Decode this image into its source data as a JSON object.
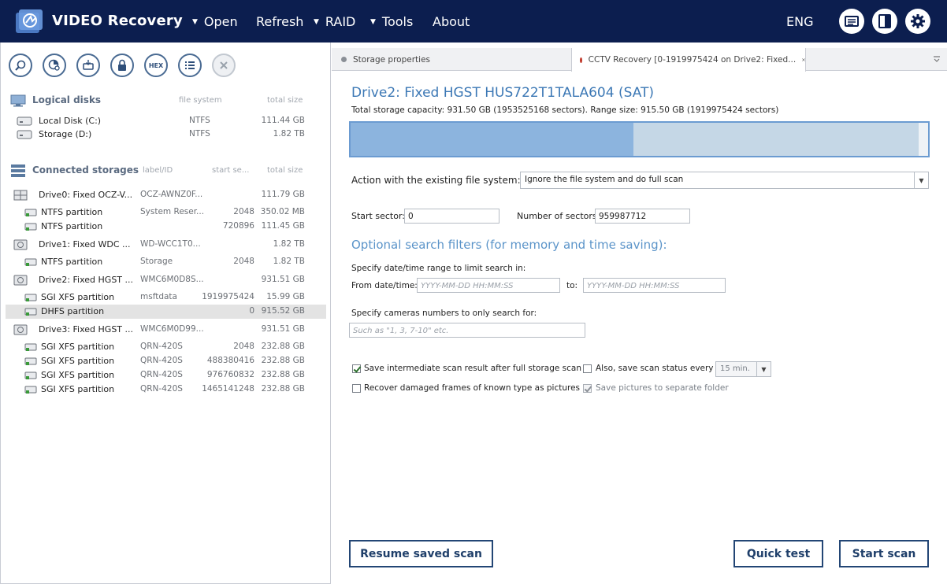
{
  "app": {
    "title": "VIDEO Recovery",
    "menu": [
      {
        "label": "Open",
        "has_caret": true
      },
      {
        "label": "Refresh",
        "has_caret": false
      },
      {
        "label": "RAID",
        "has_caret": true
      },
      {
        "label": "Tools",
        "has_caret": true
      },
      {
        "label": "About",
        "has_caret": false
      }
    ],
    "language": "ENG",
    "top_icons": [
      "log-icon",
      "panel-toggle-icon",
      "settings-icon"
    ]
  },
  "toolbar": {
    "buttons": [
      "find-icon",
      "partition-search-icon",
      "image-icon",
      "lock-icon",
      "hex-icon",
      "list-icon",
      "close-icon"
    ],
    "hex_label": "HEX"
  },
  "logical_disks": {
    "title": "Logical disks",
    "col_fs": "file system",
    "col_size": "total size",
    "items": [
      {
        "name": "Local Disk (C:)",
        "fs": "NTFS",
        "size": "111.44 GB"
      },
      {
        "name": "Storage (D:)",
        "fs": "NTFS",
        "size": "1.82 TB"
      }
    ]
  },
  "storages": {
    "title": "Connected storages",
    "col_label": "label/ID",
    "col_start": "start se...",
    "col_size": "total size",
    "rows": [
      {
        "kind": "drive",
        "name": "Drive0: Fixed OCZ-V...",
        "label": "OCZ-AWNZ0F...",
        "start": "",
        "size": "111.79 GB"
      },
      {
        "kind": "part",
        "name": "NTFS partition",
        "label": "System Reser...",
        "start": "2048",
        "size": "350.02 MB"
      },
      {
        "kind": "part",
        "name": "NTFS partition",
        "label": "",
        "start": "720896",
        "size": "111.45 GB"
      },
      {
        "kind": "drive",
        "name": "Drive1: Fixed WDC ...",
        "label": "WD-WCC1T0...",
        "start": "",
        "size": "1.82 TB"
      },
      {
        "kind": "part",
        "name": "NTFS partition",
        "label": "Storage",
        "start": "2048",
        "size": "1.82 TB"
      },
      {
        "kind": "drive",
        "name": "Drive2: Fixed HGST ...",
        "label": "WMC6M0D8S...",
        "start": "",
        "size": "931.51 GB"
      },
      {
        "kind": "part",
        "name": "SGI XFS partition",
        "label": "msftdata",
        "start": "1919975424",
        "size": "15.99 GB"
      },
      {
        "kind": "part-sel",
        "name": "DHFS partition",
        "label": "",
        "start": "0",
        "size": "915.52 GB"
      },
      {
        "kind": "drive",
        "name": "Drive3: Fixed HGST ...",
        "label": "WMC6M0D99...",
        "start": "",
        "size": "931.51 GB"
      },
      {
        "kind": "part",
        "name": "SGI XFS partition",
        "label": "QRN-420S",
        "start": "2048",
        "size": "232.88 GB"
      },
      {
        "kind": "part",
        "name": "SGI XFS partition",
        "label": "QRN-420S",
        "start": "488380416",
        "size": "232.88 GB"
      },
      {
        "kind": "part",
        "name": "SGI XFS partition",
        "label": "QRN-420S",
        "start": "976760832",
        "size": "232.88 GB"
      },
      {
        "kind": "part",
        "name": "SGI XFS partition",
        "label": "QRN-420S",
        "start": "1465141248",
        "size": "232.88 GB"
      }
    ]
  },
  "tabs": [
    {
      "label": "Storage properties",
      "dot_color": "#8a8f96"
    },
    {
      "label": "CCTV Recovery [0-1919975424 on Drive2: Fixed...",
      "dot_color": "#c0392b"
    }
  ],
  "scan": {
    "drive_title": "Drive2: Fixed HGST HUS722T1TALA604 (SAT)",
    "capacity_text": "Total storage capacity: 931.50 GB (1953525168 sectors). Range size: 915.50 GB (1919975424 sectors)",
    "range_fraction": 0.49,
    "action_label": "Action with the existing file system:",
    "action_value": "Ignore the file system and do full scan",
    "start_sector_label": "Start sector:",
    "start_sector_value": "0",
    "num_sectors_label": "Number of sectors:",
    "num_sectors_value": "959987712",
    "filters_title": "Optional search filters (for memory and time saving):",
    "date_range_hint": "Specify date/time range to limit search in:",
    "from_label": "From date/time:",
    "to_label": "to:",
    "date_placeholder": "YYYY-MM-DD HH:MM:SS",
    "cameras_hint": "Specify cameras numbers to only search for:",
    "cameras_placeholder": "Such as \"1, 3, 7-10\" etc.",
    "save_intermediate": "Save intermediate scan result after full storage scan",
    "save_status": "Also, save scan status every",
    "interval_value": "15 min.",
    "recover_damaged": "Recover damaged frames of known type as pictures",
    "save_pictures": "Save pictures to separate folder",
    "resume_btn": "Resume saved scan",
    "quick_btn": "Quick test",
    "start_btn": "Start scan"
  },
  "colors": {
    "topbar": "#0c1e4f",
    "accent": "#3c78b5",
    "button_border": "#234675"
  }
}
